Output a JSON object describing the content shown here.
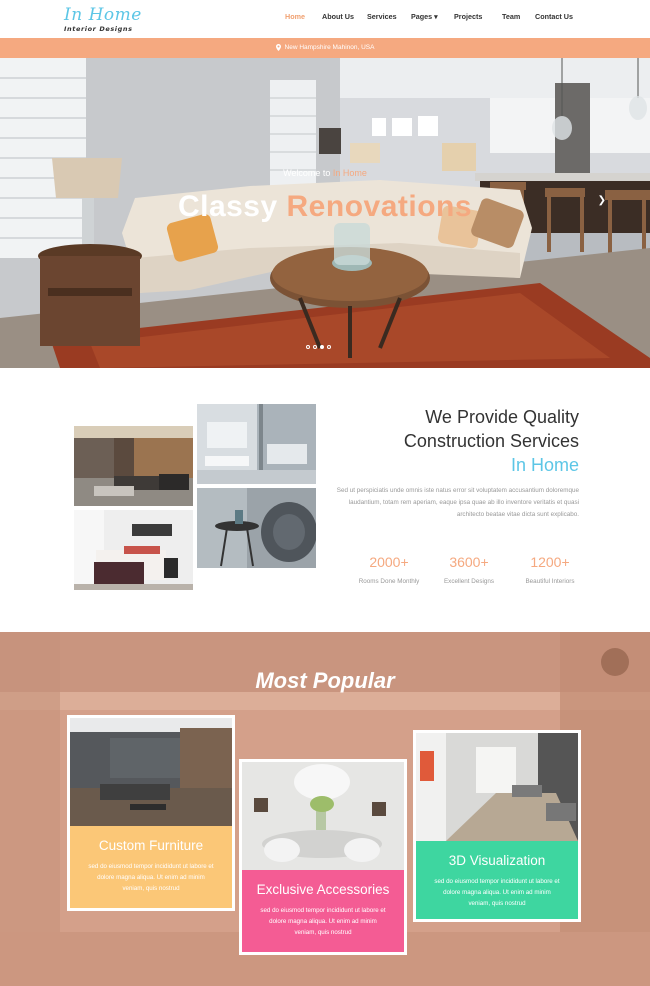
{
  "nav": {
    "logo_title": "In Home",
    "logo_subtitle": "Interior Designs",
    "items": [
      {
        "label": "Home",
        "active": true
      },
      {
        "label": "About Us"
      },
      {
        "label": "Services"
      },
      {
        "label": "Pages ▾"
      },
      {
        "label": "Projects"
      },
      {
        "label": "Team"
      },
      {
        "label": "Contact Us"
      }
    ]
  },
  "location": {
    "text": "New Hampshire Mahinon, USA",
    "icon": "map-pin-icon"
  },
  "hero": {
    "welcome_prefix": "Welcome to ",
    "welcome_brand": "In Home",
    "title_part1": "Classy ",
    "title_part2": "Renovations",
    "slides": 4,
    "active_slide": 3,
    "next_icon": "chevron-right-icon"
  },
  "services": {
    "heading_line1": "We Provide Quality",
    "heading_line2": "Construction Services",
    "heading_brand": "In Home",
    "paragraph": "Sed ut perspiciatis unde omnis iste natus error sit voluptatem accusantium doloremque laudantium, totam rem aperiam, eaque ipsa quae ab illo inventore veritatis et quasi architecto beatae vitae dicta sunt explicabo.",
    "stats": [
      {
        "value": "2000+",
        "label": "Rooms Done Monthly"
      },
      {
        "value": "3600+",
        "label": "Excellent Designs"
      },
      {
        "value": "1200+",
        "label": "Beautiful Interiors"
      }
    ]
  },
  "popular": {
    "title": "Most Popular",
    "cards": [
      {
        "title": "Custom Furniture",
        "desc": "sed do eiusmod tempor incididunt ut labore et dolore magna aliqua. Ut enim ad minim veniam, quis nostrud",
        "color": "#fbc777"
      },
      {
        "title": "Exclusive Accessories",
        "desc": "sed do eiusmod tempor incididunt ut labore et dolore magna aliqua. Ut enim ad minim veniam, quis nostrud",
        "color": "#f45c94"
      },
      {
        "title": "3D Visualization",
        "desc": "sed do eiusmod tempor incididunt ut labore et dolore magna aliqua. Ut enim ad minim veniam, quis nostrud",
        "color": "#3ed6a0"
      }
    ]
  },
  "colors": {
    "accent": "#f5a980",
    "brand": "#5cc6e6"
  }
}
